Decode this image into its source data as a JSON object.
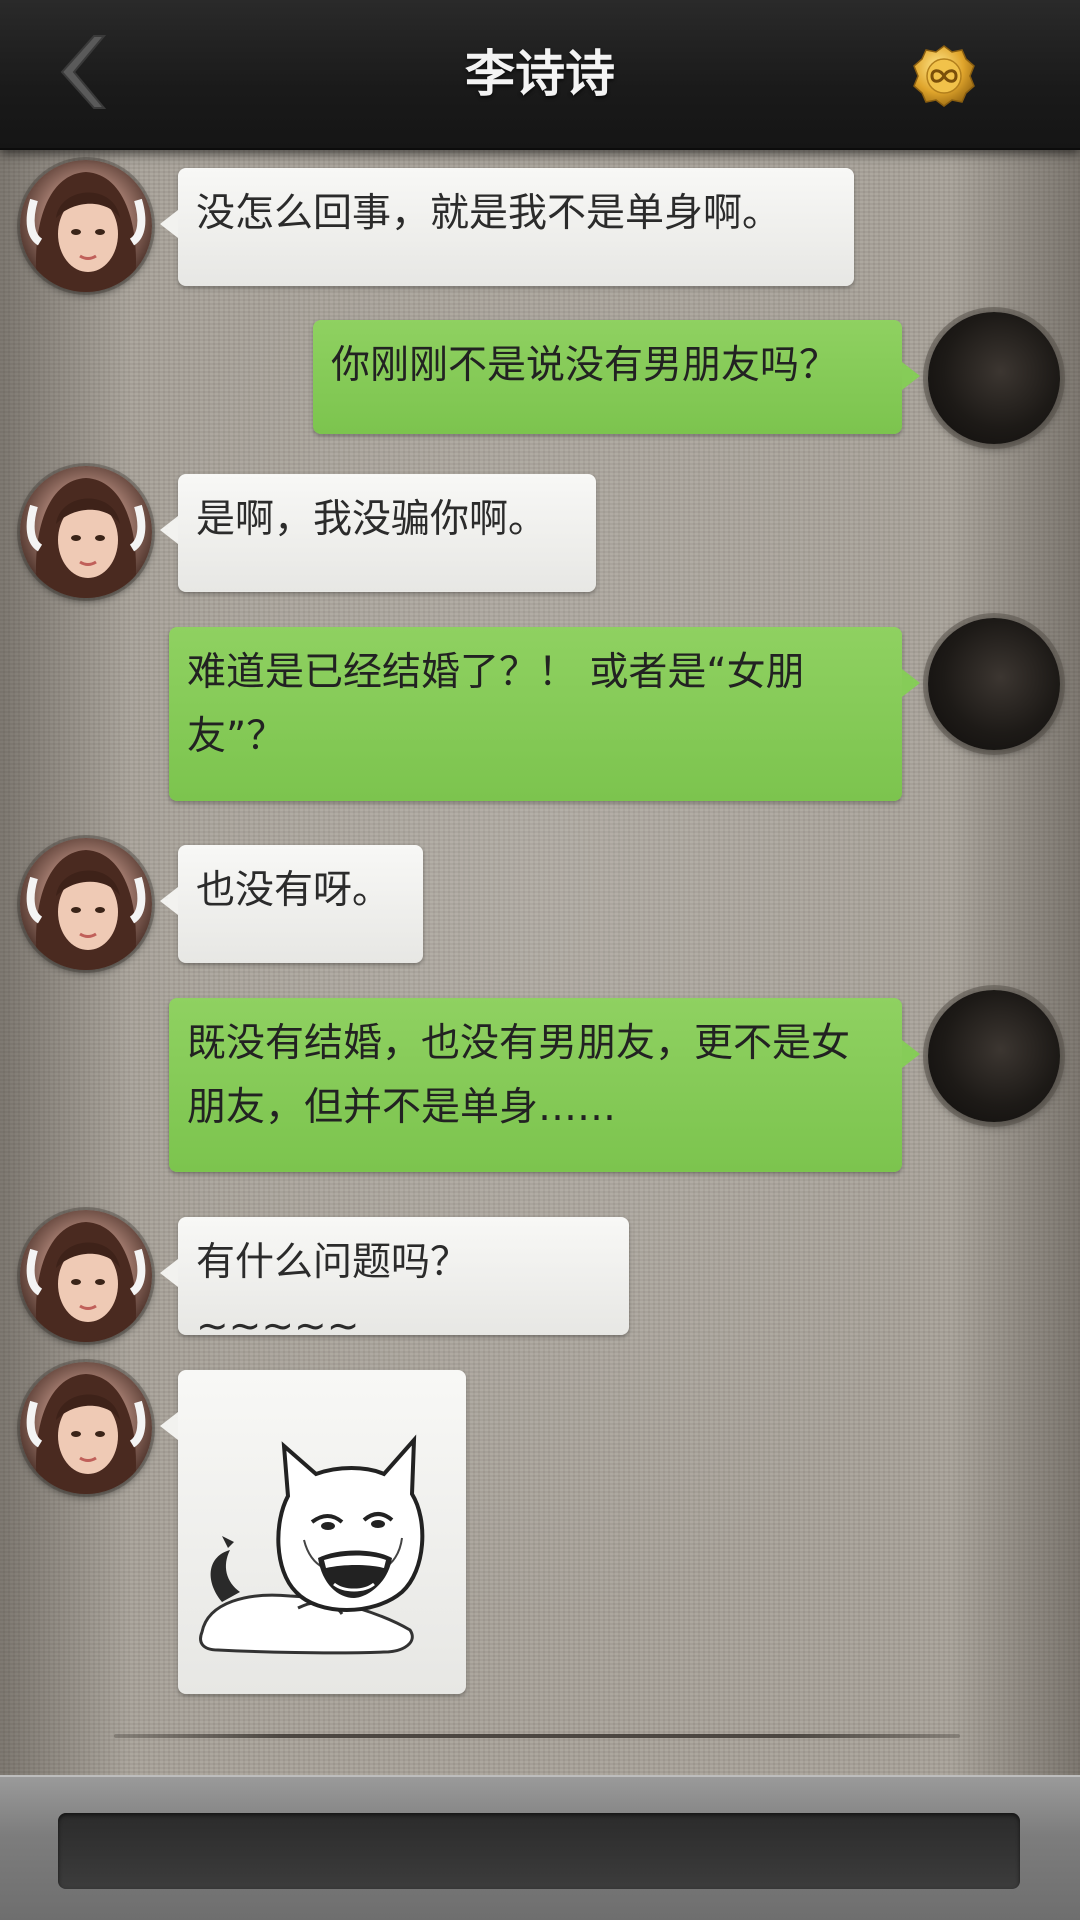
{
  "header": {
    "title": "李诗诗",
    "back_icon": "chevron-left-icon",
    "right_icon": "infinity-coin-icon"
  },
  "colors": {
    "header_bg": "#1c1c1c",
    "incoming_bubble": "#f2f2ef",
    "outgoing_bubble": "#86cc58",
    "chat_bg": "#a7a198",
    "input_bg": "#333333"
  },
  "messages": [
    {
      "sender": "contact",
      "text": "没怎么回事，就是我不是单身啊。"
    },
    {
      "sender": "me",
      "text": "你刚刚不是说没有男朋友吗？"
    },
    {
      "sender": "contact",
      "text": "是啊，我没骗你啊。"
    },
    {
      "sender": "me",
      "text": "难道是已经结婚了？！ 或者是“女朋友”？"
    },
    {
      "sender": "contact",
      "text": "也没有呀。"
    },
    {
      "sender": "me",
      "text": "既没有结婚，也没有男朋友，更不是女朋友，但并不是单身……"
    },
    {
      "sender": "contact",
      "text": "有什么问题吗？~~~~~"
    },
    {
      "sender": "contact",
      "type": "sticker",
      "sticker": "smug-cat-meme-sticker"
    }
  ]
}
